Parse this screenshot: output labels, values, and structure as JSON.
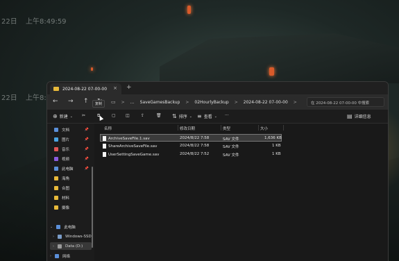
{
  "desktop": {
    "clock_top_date": "22日",
    "clock_top_time": "上午8:49:59",
    "clock_mid_date": "22日",
    "clock_mid_time": "上午8:4"
  },
  "window": {
    "tab_title": "2024-08-22 07-00-00",
    "new_tab": "+",
    "tab_close": "×"
  },
  "nav": {
    "back": "←",
    "forward": "→",
    "up": "↑",
    "refresh": "↻",
    "breadcrumbs": [
      "…",
      "SaveGamesBackup",
      "02HourlyBackup",
      "2024-08-22 07-00-00"
    ],
    "separator": ">",
    "search_placeholder": "在 2024-08-22 07-00-00 中搜索"
  },
  "toolbar": {
    "new_label": "新建",
    "sort_label": "排序",
    "view_label": "查看",
    "more_label": "···",
    "details_label": "详细信息",
    "copy_tooltip": "复制"
  },
  "sidebar": {
    "items": [
      {
        "label": "文档",
        "color": "#5b8fd9",
        "pinned": true
      },
      {
        "label": "图片",
        "color": "#4aa3e0",
        "pinned": true
      },
      {
        "label": "音乐",
        "color": "#e05555",
        "pinned": true
      },
      {
        "label": "视频",
        "color": "#8b5be0",
        "pinned": true
      },
      {
        "label": "此电脑",
        "color": "#5b8fd9",
        "pinned": true
      },
      {
        "label": "海角",
        "color": "#e8b93a",
        "pinned": false
      },
      {
        "label": "合图",
        "color": "#e8b93a",
        "pinned": false
      },
      {
        "label": "材料",
        "color": "#e8b93a",
        "pinned": false
      },
      {
        "label": "摄像",
        "color": "#e8b93a",
        "pinned": false
      }
    ],
    "tree": [
      {
        "label": "此电脑",
        "color": "#5b8fd9"
      },
      {
        "label": "Windows-SSD",
        "color": "#7a9cc8"
      },
      {
        "label": "Data (D:)",
        "color": "#9a9a9a"
      },
      {
        "label": "网络",
        "color": "#5b8fd9"
      }
    ]
  },
  "table": {
    "headers": [
      "名称",
      "修改日期",
      "类型",
      "大小"
    ],
    "rows": [
      {
        "name": "ArchiveSaveFile.1.sav",
        "date": "2024/8/22 7:58",
        "type": "SAV 文件",
        "size": "1,636 KB",
        "selected": true
      },
      {
        "name": "ShareArchiveSaveFile.sav",
        "date": "2024/8/22 7:58",
        "type": "SAV 文件",
        "size": "1 KB",
        "selected": false
      },
      {
        "name": "UserSettingSaveGame.sav",
        "date": "2024/8/22 7:52",
        "type": "SAV 文件",
        "size": "1 KB",
        "selected": false
      }
    ]
  }
}
